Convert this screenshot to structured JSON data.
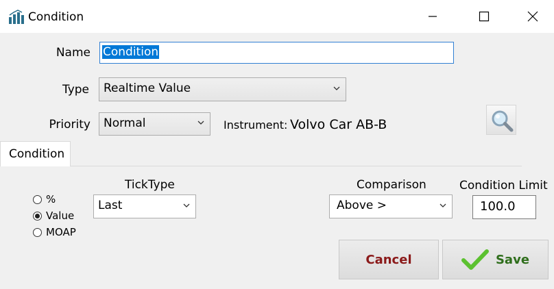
{
  "window": {
    "title": "Condition"
  },
  "form": {
    "name_label": "Name",
    "name_value": "Condition",
    "type_label": "Type",
    "type_value": "Realtime Value",
    "priority_label": "Priority",
    "priority_value": "Normal",
    "instrument_label": "Instrument:",
    "instrument_value": "Volvo Car AB-B"
  },
  "tabs": [
    {
      "label": "Condition",
      "selected": true
    }
  ],
  "condition": {
    "radios": [
      {
        "label": "%",
        "checked": false
      },
      {
        "label": "Value",
        "checked": true
      },
      {
        "label": "MOAP",
        "checked": false
      }
    ],
    "ticktype_header": "TickType",
    "ticktype_value": "Last",
    "comparison_header": "Comparison",
    "comparison_value": "Above >",
    "limit_header": "Condition Limit",
    "limit_value": "100.0"
  },
  "buttons": {
    "cancel_label": "Cancel",
    "save_label": "Save"
  },
  "colors": {
    "accent": "#0078d7",
    "cancel_text": "#8b1a1a",
    "save_text": "#2f6e1c",
    "save_check": "#5cc130"
  },
  "icons": {
    "app": "bar-chart-icon",
    "search": "magnifier-icon",
    "save": "checkmark-icon"
  }
}
